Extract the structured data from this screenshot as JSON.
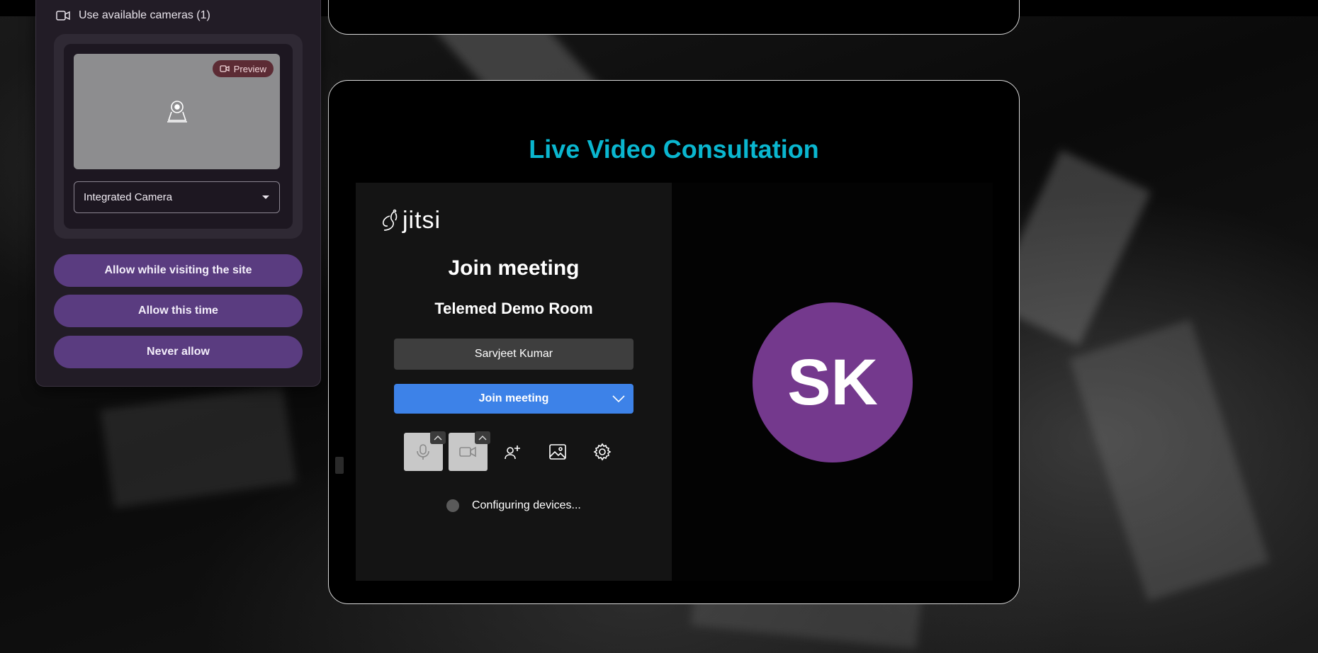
{
  "permission_popup": {
    "header_label": "Use available cameras (1)",
    "preview_chip": "Preview",
    "camera_select_value": "Integrated Camera",
    "buttons": {
      "allow_site": "Allow while visiting the site",
      "allow_once": "Allow this time",
      "never": "Never allow"
    }
  },
  "consultation": {
    "title": "Live Video Consultation"
  },
  "jitsi": {
    "logo_text": "jitsi",
    "prejoin_title": "Join meeting",
    "room_name": "Telemed Demo Room",
    "display_name_value": "Sarvjeet Kumar",
    "join_button": "Join meeting",
    "status_text": "Configuring devices...",
    "avatar_initials": "SK"
  },
  "colors": {
    "title_accent": "#0ab6cf",
    "join_button": "#3d82e8",
    "avatar_bg": "#74398d",
    "permission_button": "#5a3c80"
  },
  "icons": {
    "popup_header": "video-camera-icon",
    "preview_chip": "video-camera-icon",
    "camera_placeholder": "webcam-icon",
    "join_dropdown": "chevron-down-icon",
    "mic_toggle": "microphone-icon",
    "camera_toggle": "video-camera-icon",
    "invite": "add-person-icon",
    "background": "image-icon",
    "settings": "gear-icon"
  }
}
